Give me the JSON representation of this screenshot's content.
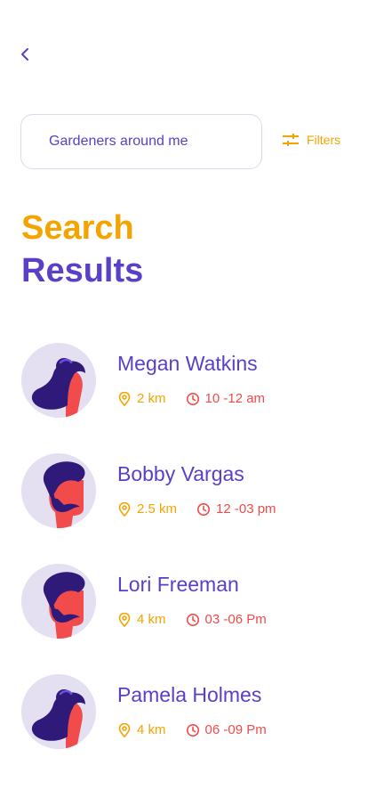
{
  "search": {
    "value": "Gardeners around me"
  },
  "filters": {
    "label": "Filters"
  },
  "title": {
    "line1": "Search",
    "line2": "Results"
  },
  "colors": {
    "accent_orange": "#f5a300",
    "accent_purple": "#5b3fc7",
    "accent_red": "#f14b4b",
    "avatar_bg": "#e4e0f2"
  },
  "results": [
    {
      "name": "Megan Watkins",
      "distance": "2 km",
      "time": "10 -12 am",
      "avatar": "female"
    },
    {
      "name": "Bobby Vargas",
      "distance": "2.5 km",
      "time": "12 -03 pm",
      "avatar": "male"
    },
    {
      "name": "Lori Freeman",
      "distance": "4 km",
      "time": "03 -06 Pm",
      "avatar": "male"
    },
    {
      "name": "Pamela Holmes",
      "distance": "4 km",
      "time": "06 -09 Pm",
      "avatar": "female"
    }
  ]
}
